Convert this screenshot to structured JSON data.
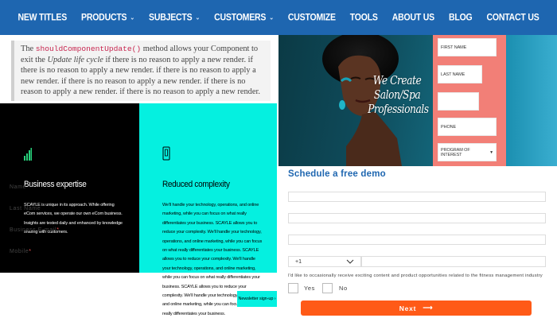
{
  "nav": {
    "items": [
      {
        "label": "NEW TITLES",
        "dropdown": false
      },
      {
        "label": "PRODUCTS",
        "dropdown": true
      },
      {
        "label": "SUBJECTS",
        "dropdown": true
      },
      {
        "label": "CUSTOMERS",
        "dropdown": true
      },
      {
        "label": "CUSTOMIZE",
        "dropdown": false
      },
      {
        "label": "TOOLS",
        "dropdown": false
      },
      {
        "label": "ABOUT US",
        "dropdown": false
      },
      {
        "label": "BLOG",
        "dropdown": false
      },
      {
        "label": "CONTACT US",
        "dropdown": false
      }
    ],
    "chevron": "⌄",
    "background": "#1e66b0"
  },
  "doc": {
    "intro": "The ",
    "code": "shouldComponentUpdate()",
    "middle": " method allows your Component to exit the ",
    "emphasis": "Update life cycle",
    "rest": " if there is no reason to apply a new render. if there is no reason to apply a new render. if there is no reason to apply a new render. if there is no reason to apply a new render. if there is no reason to apply a new render. if there is no reason to apply a new render."
  },
  "features": {
    "business": {
      "icon": "bar-chart-icon",
      "title": "Business expertise",
      "body": "SCAYLE is unique in its approach. While offering eCom services, we operate our own eCom business. Insights are tested daily and enhanced by knowledge sharing with customers."
    },
    "complexity": {
      "icon": "phone-icon",
      "title": "Reduced complexity",
      "body": "We'll handle your technology, operations, and online marketing, while you can focus on what really differentiates your business. SCAYLE allows you to reduce your complexity. We'll handle your technology, operations, and online marketing, while you can focus on what really differentiates your business. SCAYLE allows you to reduce your complexity. We'll handle your technology, operations, and online marketing, while you can focus on what really differentiates your business. SCAYLE allows you to reduce your complexity. We'll handle your technology, operations, and online marketing, while you can focus on what really differentiates your business."
    },
    "signup_label": "Newsletter sign-up ›",
    "colors": {
      "black": "#000000",
      "teal": "#05f0e0"
    }
  },
  "hero": {
    "headline": "We Create Salon/Spa Professionals",
    "form": {
      "first_name": "FIRST NAME",
      "last_name": "LAST NAME",
      "email": "",
      "phone": "PHONE",
      "program": "PROGRAM OF INTEREST"
    },
    "form_color": "#f27f77"
  },
  "demo": {
    "title": "Schedule a free demo",
    "name_label": "Name",
    "last_name_label": "Last Name",
    "email_label": "Business E-mail",
    "mobile_label": "Mobile",
    "required_mark": "*",
    "dial_code": "+1",
    "consent": "I'd like to occasionally receive exciting content and product opportunities related to the fitness management industry",
    "yes_label": "Yes",
    "no_label": "No",
    "next_label": "Next",
    "next_arrow": "⟶",
    "button_color": "#ff5a17",
    "title_color": "#1e66b0"
  }
}
